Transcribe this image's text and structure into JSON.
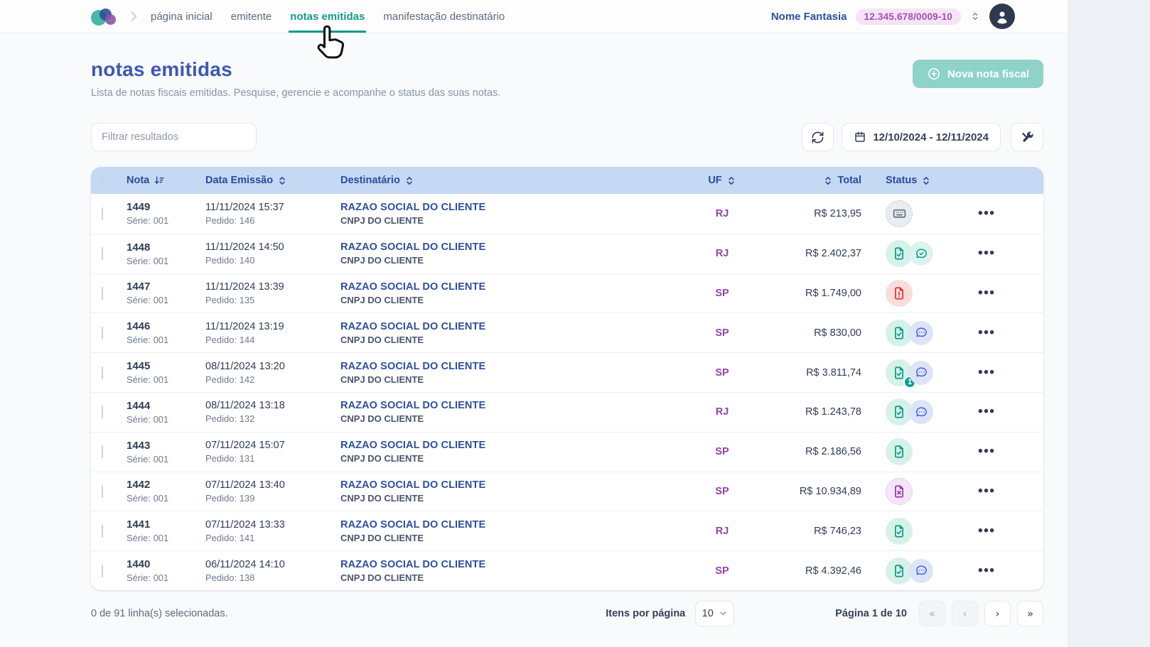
{
  "nav": {
    "items": [
      {
        "label": "página inicial",
        "active": false
      },
      {
        "label": "emitente",
        "active": false
      },
      {
        "label": "notas emitidas",
        "active": true
      },
      {
        "label": "manifestação destinatário",
        "active": false
      }
    ],
    "company_name": "Nome Fantasia",
    "company_cnpj": "12.345.678/0009-10"
  },
  "page": {
    "title": "notas emitidas",
    "subtitle": "Lista de notas fiscais emitidas. Pesquise, gerencie e acompanhe o status das suas notas.",
    "new_button_label": "Nova nota fiscal"
  },
  "toolbar": {
    "filter_placeholder": "Filtrar resultados",
    "date_range": "12/10/2024 - 12/11/2024"
  },
  "table": {
    "columns": {
      "nota": "Nota",
      "data": "Data Emissão",
      "dest": "Destinatário",
      "uf": "UF",
      "total": "Total",
      "status": "Status"
    },
    "rows": [
      {
        "nota": "1449",
        "serie": "Série: 001",
        "data": "11/11/2024 15:37",
        "pedido": "Pedido: 146",
        "destinatario": "RAZAO SOCIAL DO CLIENTE",
        "cnpj": "CNPJ DO CLIENTE",
        "uf": "RJ",
        "total": "R$ 213,95",
        "status": [
          "keyboard"
        ],
        "badge": ""
      },
      {
        "nota": "1448",
        "serie": "Série: 001",
        "data": "11/11/2024 14:50",
        "pedido": "Pedido: 140",
        "destinatario": "RAZAO SOCIAL DO CLIENTE",
        "cnpj": "CNPJ DO CLIENTE",
        "uf": "RJ",
        "total": "R$ 2.402,37",
        "status": [
          "doc-check",
          "chat-check"
        ],
        "badge": ""
      },
      {
        "nota": "1447",
        "serie": "Série: 001",
        "data": "11/11/2024 13:39",
        "pedido": "Pedido: 135",
        "destinatario": "RAZAO SOCIAL DO CLIENTE",
        "cnpj": "CNPJ DO CLIENTE",
        "uf": "SP",
        "total": "R$ 1.749,00",
        "status": [
          "doc-alert"
        ],
        "badge": ""
      },
      {
        "nota": "1446",
        "serie": "Série: 001",
        "data": "11/11/2024 13:19",
        "pedido": "Pedido: 144",
        "destinatario": "RAZAO SOCIAL DO CLIENTE",
        "cnpj": "CNPJ DO CLIENTE",
        "uf": "SP",
        "total": "R$ 830,00",
        "status": [
          "doc-check",
          "chat-dots"
        ],
        "badge": ""
      },
      {
        "nota": "1445",
        "serie": "Série: 001",
        "data": "08/11/2024 13:20",
        "pedido": "Pedido: 142",
        "destinatario": "RAZAO SOCIAL DO CLIENTE",
        "cnpj": "CNPJ DO CLIENTE",
        "uf": "SP",
        "total": "R$ 3.811,74",
        "status": [
          "doc-check",
          "chat-dots"
        ],
        "badge": "1"
      },
      {
        "nota": "1444",
        "serie": "Série: 001",
        "data": "08/11/2024 13:18",
        "pedido": "Pedido: 132",
        "destinatario": "RAZAO SOCIAL DO CLIENTE",
        "cnpj": "CNPJ DO CLIENTE",
        "uf": "RJ",
        "total": "R$ 1.243,78",
        "status": [
          "doc-check",
          "chat-dots"
        ],
        "badge": ""
      },
      {
        "nota": "1443",
        "serie": "Série: 001",
        "data": "07/11/2024 15:07",
        "pedido": "Pedido: 131",
        "destinatario": "RAZAO SOCIAL DO CLIENTE",
        "cnpj": "CNPJ DO CLIENTE",
        "uf": "SP",
        "total": "R$ 2.186,56",
        "status": [
          "doc-check"
        ],
        "badge": ""
      },
      {
        "nota": "1442",
        "serie": "Série: 001",
        "data": "07/11/2024 13:40",
        "pedido": "Pedido: 139",
        "destinatario": "RAZAO SOCIAL DO CLIENTE",
        "cnpj": "CNPJ DO CLIENTE",
        "uf": "SP",
        "total": "R$ 10.934,89",
        "status": [
          "doc-x"
        ],
        "badge": ""
      },
      {
        "nota": "1441",
        "serie": "Série: 001",
        "data": "07/11/2024 13:33",
        "pedido": "Pedido: 141",
        "destinatario": "RAZAO SOCIAL DO CLIENTE",
        "cnpj": "CNPJ DO CLIENTE",
        "uf": "RJ",
        "total": "R$ 746,23",
        "status": [
          "doc-check"
        ],
        "badge": ""
      },
      {
        "nota": "1440",
        "serie": "Série: 001",
        "data": "06/11/2024 14:10",
        "pedido": "Pedido: 138",
        "destinatario": "RAZAO SOCIAL DO CLIENTE",
        "cnpj": "CNPJ DO CLIENTE",
        "uf": "SP",
        "total": "R$ 4.392,46",
        "status": [
          "doc-check",
          "chat-dots"
        ],
        "badge": ""
      }
    ]
  },
  "footer": {
    "selection_text": "0 de 91 linha(s) selecionadas.",
    "items_per_page_label": "Itens por página",
    "items_per_page_value": "10",
    "page_indicator": "Página 1 de 10",
    "pager": {
      "first": "«",
      "prev": "‹",
      "next": "›",
      "last": "»"
    }
  },
  "colors": {
    "accent_teal": "#149a8c",
    "title_blue": "#3d59b2",
    "link_blue": "#2d4f9e",
    "uf_purple": "#9244a7",
    "header_blue": "#c5d8f4",
    "status_green": "#0b9c8b",
    "status_red": "#e03434",
    "status_chat_blue": "#4263eb",
    "status_cancel_purple": "#9c36b5",
    "new_button_teal": "#8ed2c9",
    "cnpj_pill_bg": "#f6e4f6"
  }
}
